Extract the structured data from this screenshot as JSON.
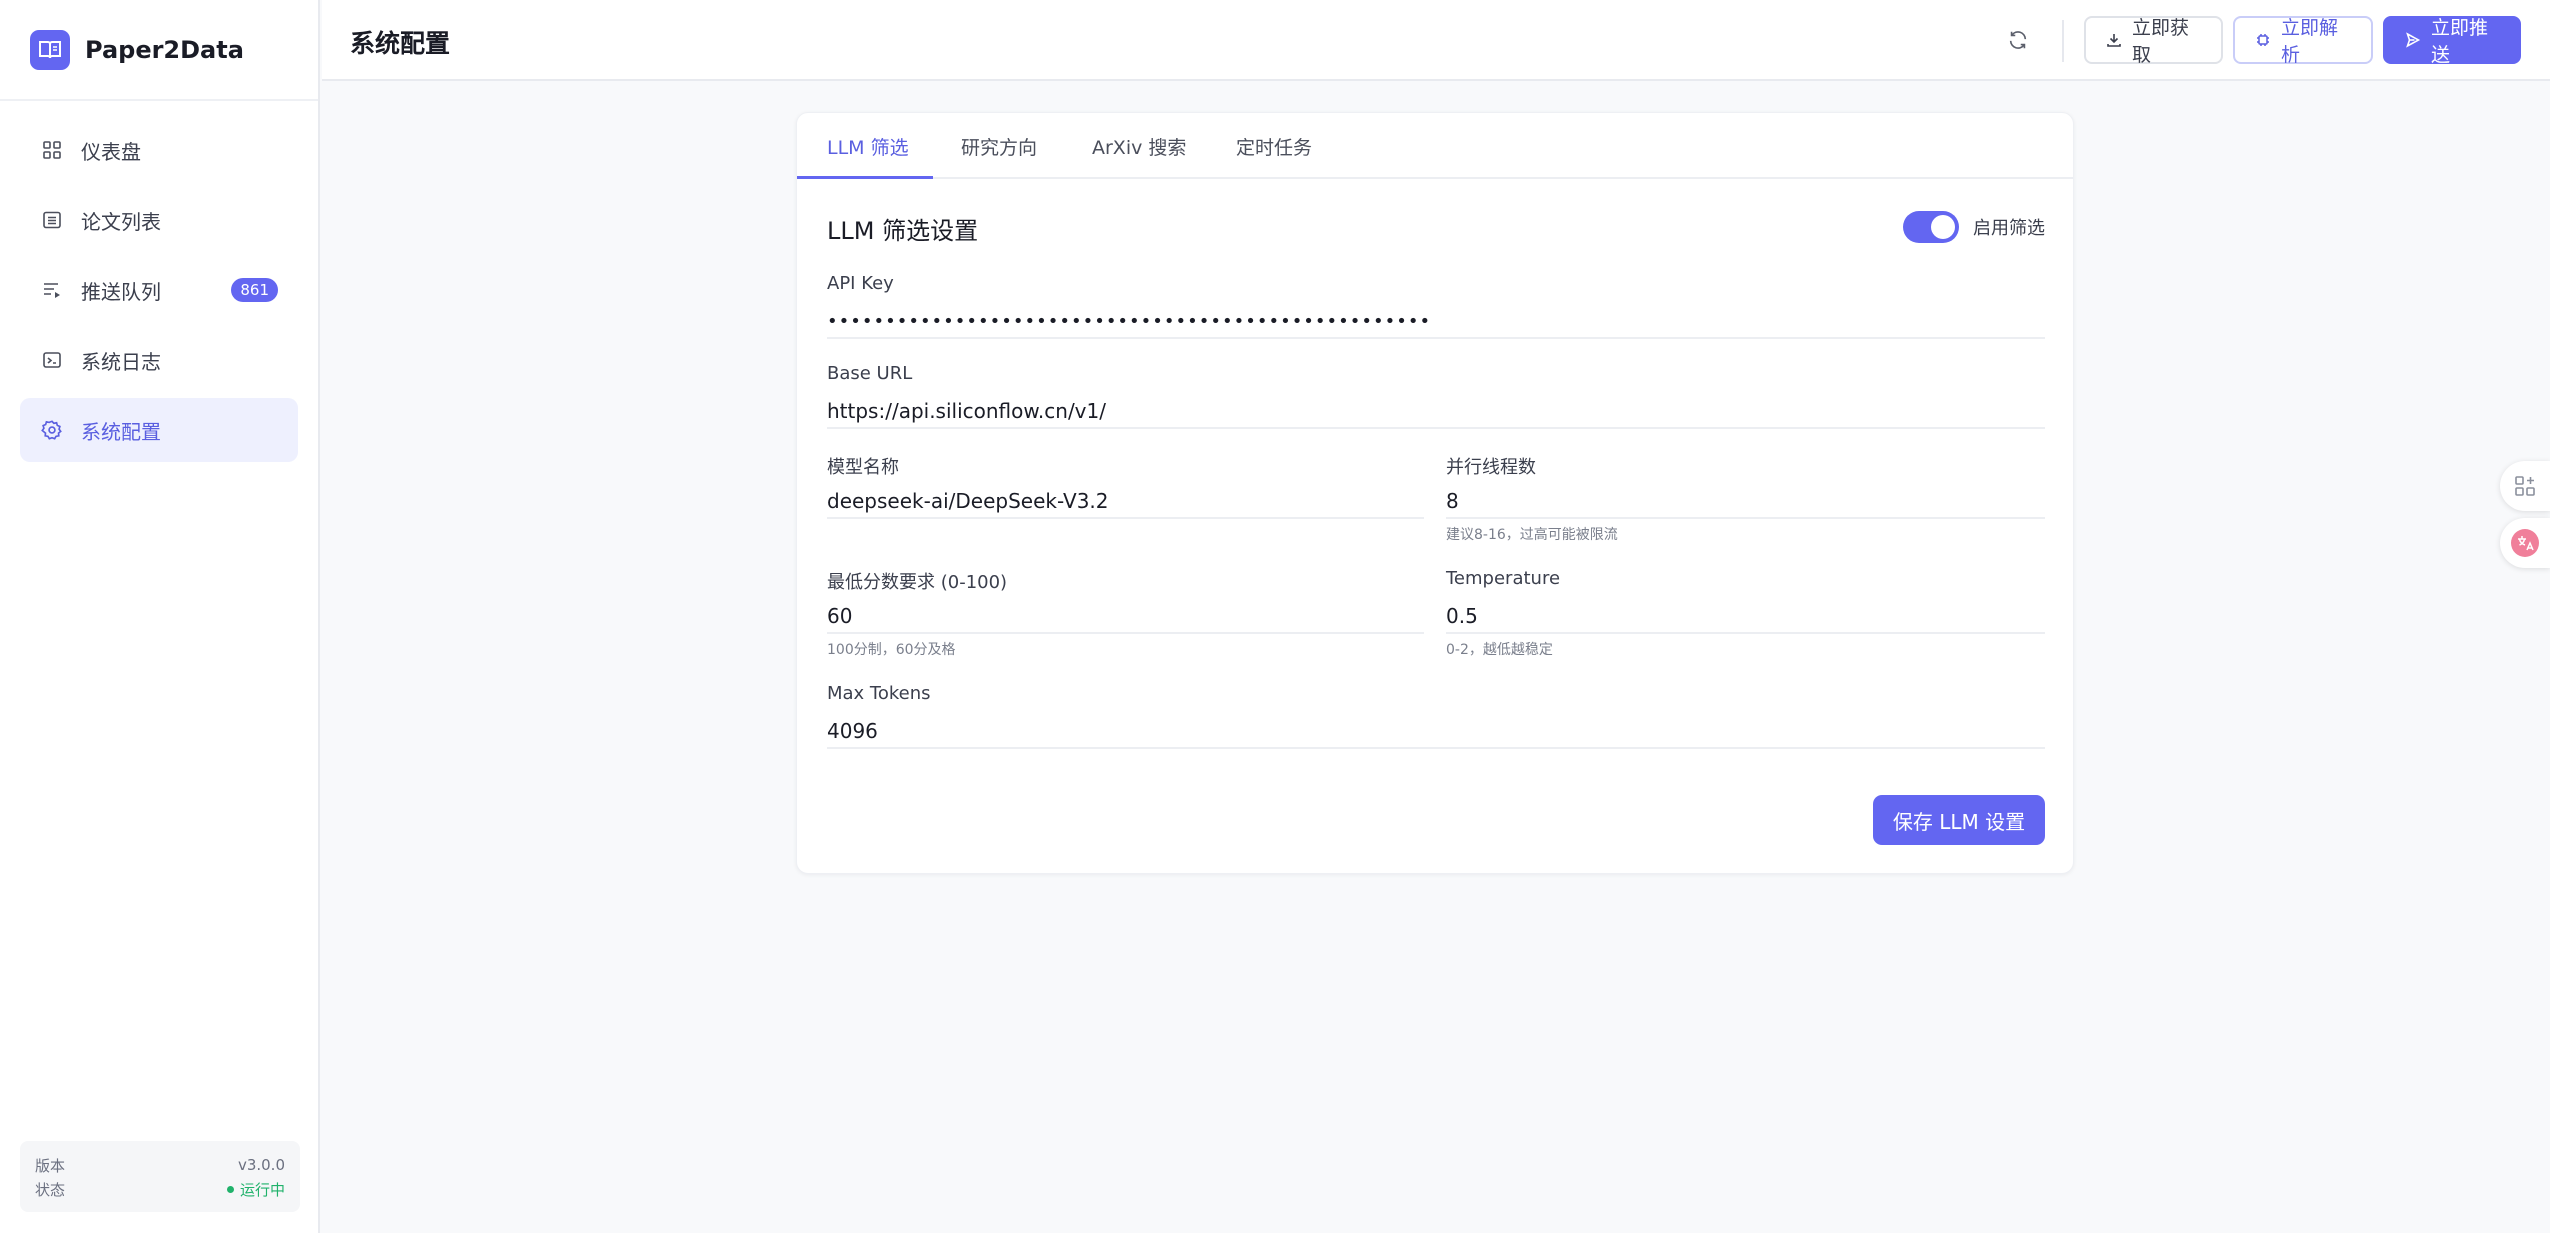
{
  "brand": {
    "name": "Paper2Data"
  },
  "sidebar": {
    "items": [
      {
        "label": "仪表盘",
        "icon": "grid-icon"
      },
      {
        "label": "论文列表",
        "icon": "list-icon"
      },
      {
        "label": "推送队列",
        "icon": "queue-icon",
        "badge": "861"
      },
      {
        "label": "系统日志",
        "icon": "terminal-icon"
      },
      {
        "label": "系统配置",
        "icon": "gear-icon",
        "active": true
      }
    ],
    "footer": {
      "version_label": "版本",
      "version_value": "v3.0.0",
      "status_label": "状态",
      "status_value": "运行中"
    }
  },
  "header": {
    "title": "系统配置",
    "fetch_label": "立即获取",
    "parse_label": "立即解析",
    "push_label": "立即推送"
  },
  "tabs": [
    {
      "label": "LLM 筛选"
    },
    {
      "label": "研究方向"
    },
    {
      "label": "ArXiv 搜索"
    },
    {
      "label": "定时任务"
    }
  ],
  "llm": {
    "section_title": "LLM 筛选设置",
    "toggle_label": "启用筛选",
    "toggle_on": true,
    "api_key_label": "API Key",
    "api_key_value": "••••••••••••••••••••••••••••••••••••••••••••••••••••",
    "base_url_label": "Base URL",
    "base_url_value": "https://api.siliconflow.cn/v1/",
    "model_label": "模型名称",
    "model_value": "deepseek-ai/DeepSeek-V3.2",
    "threads_label": "并行线程数",
    "threads_value": "8",
    "threads_hint": "建议8-16，过高可能被限流",
    "min_score_label": "最低分数要求 (0-100)",
    "min_score_value": "60",
    "min_score_hint": "100分制，60分及格",
    "temperature_label": "Temperature",
    "temperature_value": "0.5",
    "temperature_hint": "0-2，越低越稳定",
    "max_tokens_label": "Max Tokens",
    "max_tokens_value": "4096",
    "save_label": "保存 LLM 设置"
  },
  "colors": {
    "accent": "#6366f1",
    "status_ok": "#20b26b"
  }
}
